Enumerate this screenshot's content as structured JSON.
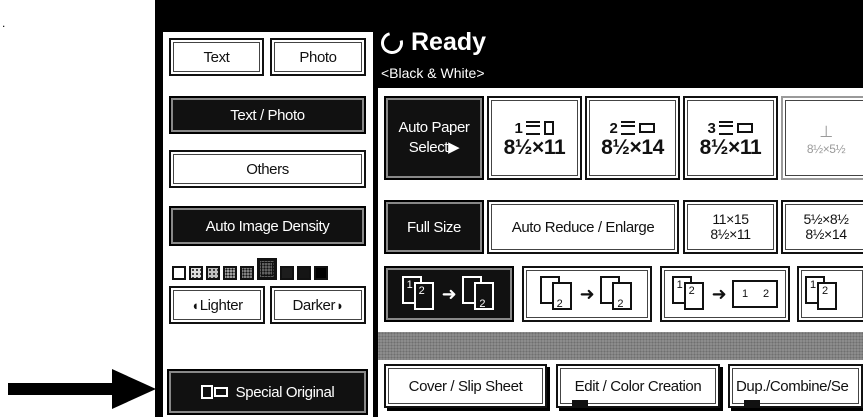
{
  "left_panel": {
    "text_label": "Text",
    "photo_label": "Photo",
    "text_photo_label": "Text / Photo",
    "others_label": "Others",
    "auto_density_label": "Auto Image Density",
    "lighter_label": "Lighter",
    "darker_label": "Darker",
    "special_original_label": "Special Original",
    "density_levels": 9,
    "density_selected": 5
  },
  "header": {
    "status": "Ready",
    "mode": "<Black & White>"
  },
  "paper": {
    "auto_paper_select_line1": "Auto Paper",
    "auto_paper_select_line2": "Select",
    "trays": [
      {
        "number": "1",
        "size": "8½×11"
      },
      {
        "number": "2",
        "size": "8½×14"
      },
      {
        "number": "3",
        "size": "8½×11"
      }
    ],
    "bypass_size": "8½×5½"
  },
  "ratio": {
    "full_size_label": "Full Size",
    "auto_reduce_enlarge_label": "Auto Reduce / Enlarge",
    "preset1_top": "11×15",
    "preset1_bottom": "8½×11",
    "preset2_top": "5½×8½",
    "preset2_bottom": "8½×14"
  },
  "duplex": {
    "icon_labels": [
      "1",
      "2"
    ]
  },
  "bottom_tabs": {
    "cover_slip_label": "Cover / Slip Sheet",
    "edit_color_label": "Edit / Color Creation",
    "dup_combine_label": "Dup./Combine/Se"
  },
  "page_marker": "."
}
